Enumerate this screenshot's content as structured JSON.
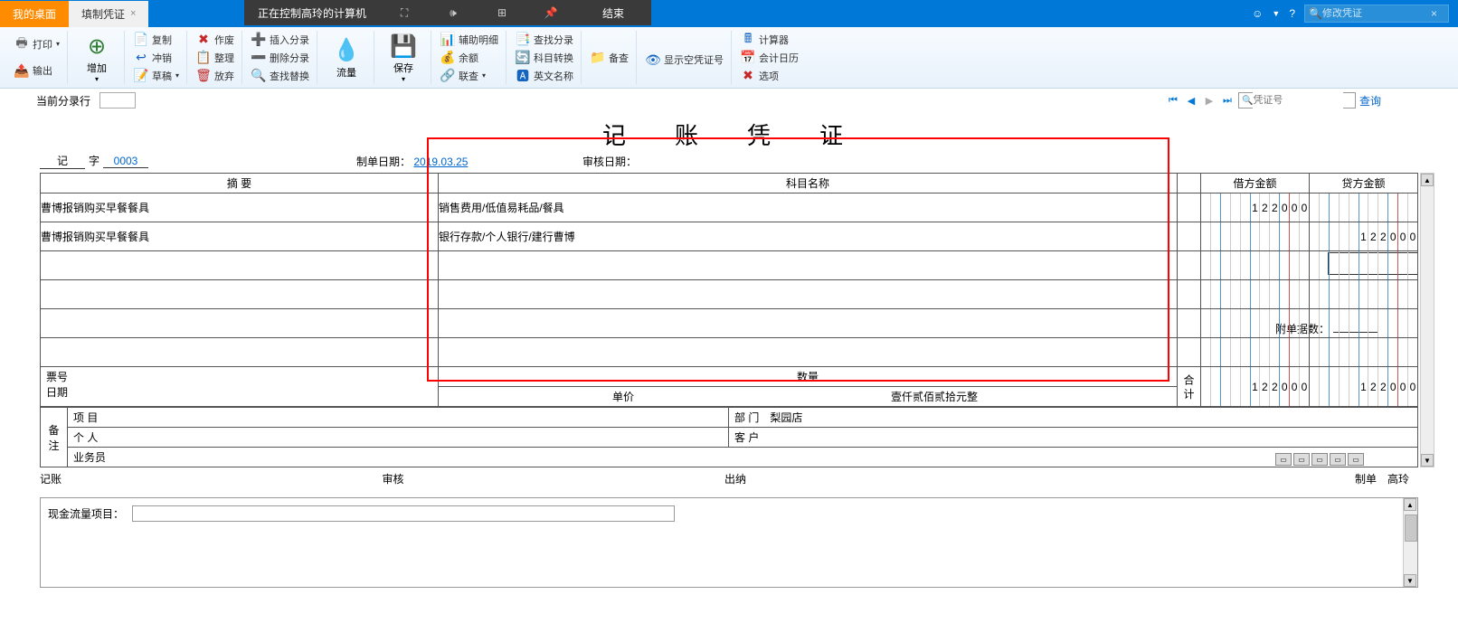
{
  "remote": {
    "message": "正在控制高玲的计算机",
    "end": "结束"
  },
  "tabs": {
    "desktop": "我的桌面",
    "voucher": "填制凭证"
  },
  "search": {
    "placeholder": "修改凭证"
  },
  "ribbon": {
    "print": "打印",
    "output": "输出",
    "add": "增加",
    "copy": "复制",
    "offset": "冲销",
    "draft": "草稿",
    "void": "作废",
    "arrange": "整理",
    "discard": "放弃",
    "insertEntry": "插入分录",
    "deleteEntry": "删除分录",
    "findReplace": "查找替换",
    "flow": "流量",
    "save": "保存",
    "auxDetail": "辅助明细",
    "balance": "余额",
    "crossCheck": "联查",
    "findEntry": "查找分录",
    "acctConvert": "科目转换",
    "engName": "英文名称",
    "showEmpty": "显示空凭证号",
    "calculator": "计算器",
    "calendar": "会计日历",
    "options": "选项",
    "audit": "备查"
  },
  "entryBar": {
    "label": "当前分录行",
    "voucherNoPh": "凭证号",
    "query": "查询"
  },
  "voucher": {
    "title": "记　账　凭　证",
    "prefix": "记",
    "wordLabel": "字",
    "number": "0003",
    "makeDateLabel": "制单日期：",
    "makeDate": "2019.03.25",
    "auditDateLabel": "审核日期：",
    "attachLabel": "附单据数：",
    "headers": {
      "summary": "摘 要",
      "account": "科目名称",
      "debit": "借方金额",
      "credit": "贷方金额"
    },
    "rows": [
      {
        "summary": "曹博报销购买早餐餐具",
        "account": "销售费用/低值易耗品/餐具",
        "debit": "122000",
        "credit": ""
      },
      {
        "summary": "曹博报销购买早餐餐具",
        "account": "银行存款/个人银行/建行曹博",
        "debit": "",
        "credit": "122000"
      },
      {
        "summary": "",
        "account": "",
        "debit": "",
        "credit": ""
      },
      {
        "summary": "",
        "account": "",
        "debit": "",
        "credit": ""
      },
      {
        "summary": "",
        "account": "",
        "debit": "",
        "credit": ""
      },
      {
        "summary": "",
        "account": "",
        "debit": "",
        "credit": ""
      }
    ],
    "ticketLabel": "票号",
    "dateLabel2": "日期",
    "qtyLabel": "数量",
    "priceLabel": "单价",
    "totalLabel": "合 计",
    "totalWords": "壹仟贰佰贰拾元整",
    "totalDebit": "122000",
    "totalCredit": "122000",
    "noteLabel": "备注",
    "projectLabel": "项 目",
    "deptLabel": "部 门",
    "deptValue": "梨园店",
    "personLabel": "个 人",
    "customerLabel": "客 户",
    "salesLabel": "业务员",
    "sig": {
      "book": "记账",
      "audit": "审核",
      "cashier": "出纳",
      "maker": "制单",
      "makerName": "高玲"
    },
    "cashflowLabel": "现金流量项目："
  }
}
